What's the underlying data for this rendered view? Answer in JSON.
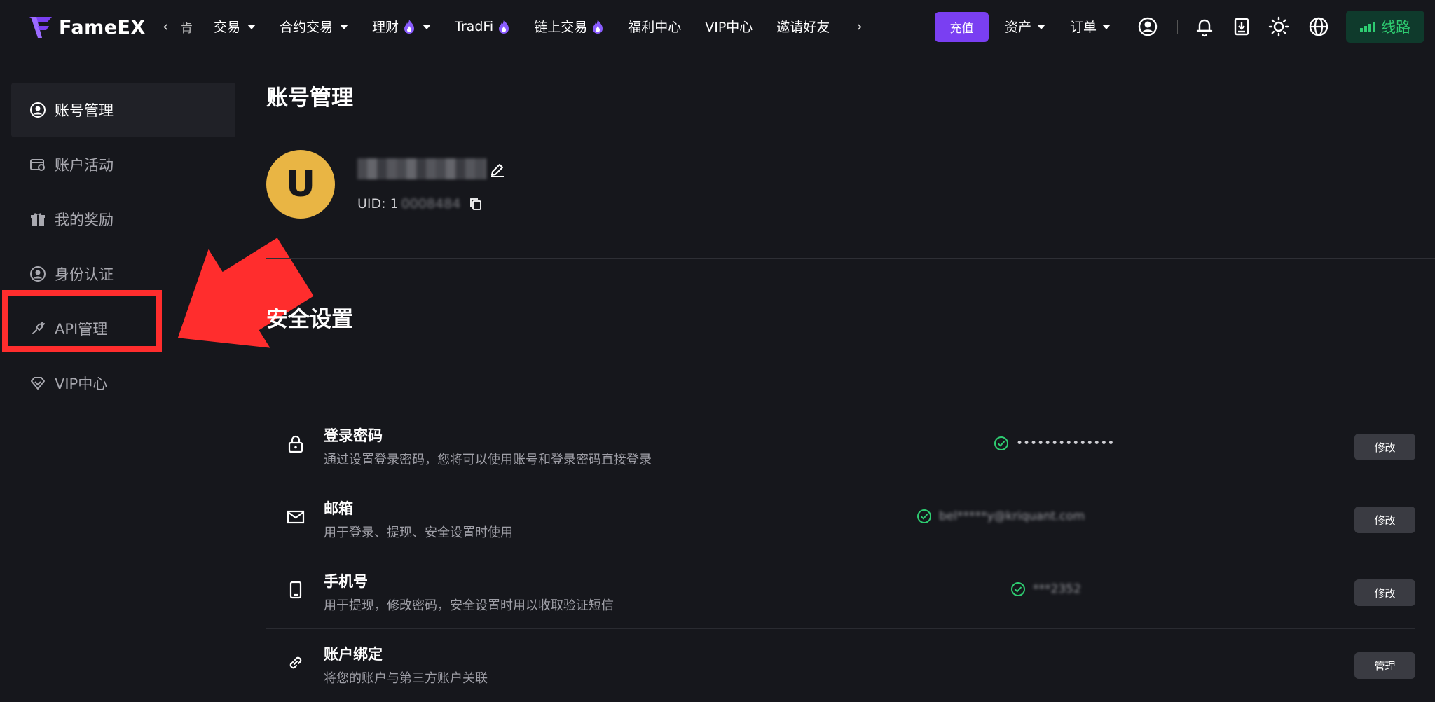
{
  "brand": {
    "name": "FameEX"
  },
  "nav": {
    "prev_arrow": "‹",
    "truncated_item": "肯",
    "items": [
      {
        "label": "交易",
        "has_caret": true,
        "hot": false
      },
      {
        "label": "合约交易",
        "has_caret": true,
        "hot": false
      },
      {
        "label": "理财",
        "has_caret": true,
        "hot": true
      },
      {
        "label": "TradFi",
        "has_caret": false,
        "hot": true
      },
      {
        "label": "链上交易",
        "has_caret": false,
        "hot": true
      },
      {
        "label": "福利中心",
        "has_caret": false,
        "hot": false
      },
      {
        "label": "VIP中心",
        "has_caret": false,
        "hot": false
      },
      {
        "label": "邀请好友",
        "has_caret": false,
        "hot": false
      }
    ],
    "next_arrow": "›",
    "deposit_label": "充值",
    "assets_label": "资产",
    "orders_label": "订单",
    "route_label": "线路",
    "icons": [
      "user-circle-icon",
      "bell-icon",
      "download-icon",
      "sun-icon",
      "globe-icon"
    ]
  },
  "sidebar": {
    "items": [
      {
        "label": "账号管理",
        "icon": "user-circle-icon",
        "active": true
      },
      {
        "label": "账户活动",
        "icon": "activity-icon",
        "active": false
      },
      {
        "label": "我的奖励",
        "icon": "gift-icon",
        "active": false
      },
      {
        "label": "身份认证",
        "icon": "id-icon",
        "active": false
      },
      {
        "label": "API管理",
        "icon": "api-icon",
        "active": false
      },
      {
        "label": "VIP中心",
        "icon": "diamond-icon",
        "active": false
      }
    ]
  },
  "annotation": {
    "color": "#ff2d2d",
    "target": "API管理"
  },
  "main": {
    "title": "账号管理",
    "avatar_letter": "U",
    "uid_prefix": "UID: 1",
    "uid_masked": "0008484",
    "security_title": "安全设置",
    "rows": [
      {
        "title": "登录密码",
        "desc": "通过设置登录密码，您将可以使用账号和登录密码直接登录",
        "status": "••••••••••••••",
        "blurred": false,
        "action": "修改",
        "icon": "lock-icon"
      },
      {
        "title": "邮箱",
        "desc": "用于登录、提现、安全设置时使用",
        "status": "bel*****y@kriquant.com",
        "blurred": true,
        "action": "修改",
        "icon": "mail-icon"
      },
      {
        "title": "手机号",
        "desc": "用于提现，修改密码，安全设置时用以收取验证短信",
        "status": "***2352",
        "blurred": true,
        "action": "修改",
        "icon": "phone-icon"
      },
      {
        "title": "账户绑定",
        "desc": "将您的账户与第三方账户关联",
        "status": "",
        "blurred": false,
        "action": "管理",
        "icon": "link-icon"
      }
    ]
  },
  "colors": {
    "background": "#16171c",
    "accent": "#7a3ff2",
    "success": "#2ecc71",
    "avatar": "#e9b544"
  }
}
